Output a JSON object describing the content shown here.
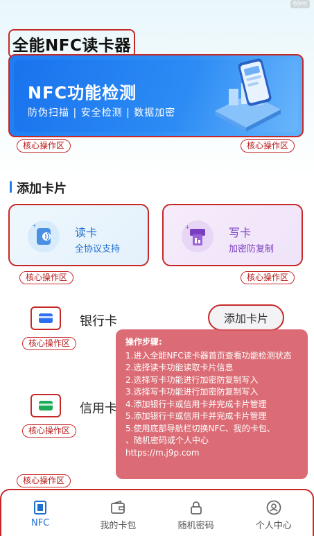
{
  "status": {
    "right_text": "69m"
  },
  "header": {
    "app_title": "全能NFC读卡器"
  },
  "hero": {
    "title": "NFC功能检测",
    "subtitle": "防伪扫描 | 安全检测 | 数据加密"
  },
  "tags": {
    "core_area": "核心操作区"
  },
  "section": {
    "title": "添加卡片"
  },
  "cards": {
    "read": {
      "title": "读卡",
      "subtitle": "全协议支持"
    },
    "write": {
      "title": "写卡",
      "subtitle": "加密防复制"
    }
  },
  "rows": {
    "bank_card": {
      "label": "银行卡",
      "icon": "bank-card-icon",
      "color": "#2e6ff2"
    },
    "credit_card": {
      "label": "信用卡",
      "icon": "credit-card-icon",
      "color": "#1faa59"
    }
  },
  "add_card_button": {
    "label": "添加卡片"
  },
  "popup": {
    "header": "操作步骤:",
    "steps": [
      "1.进入全能NFC读卡器首页查看功能检测状态",
      "2.选择读卡功能读取卡片信息",
      "2.选择写卡功能进行加密防复制写入",
      "3.选择写卡功能进行加密防复制写入",
      "4.添加银行卡或信用卡并完成卡片管理",
      "5.添加银行卡或信用卡并完成卡片管理",
      "5.使用底部导航栏切换NFC、我的卡包、",
      "、随机密码或个人中心",
      "https://m.j9p.com"
    ]
  },
  "nav": {
    "items": [
      {
        "label": "NFC",
        "icon": "nfc-icon"
      },
      {
        "label": "我的卡包",
        "icon": "wallet-icon"
      },
      {
        "label": "随机密码",
        "icon": "lock-icon"
      },
      {
        "label": "个人中心",
        "icon": "user-icon"
      }
    ]
  },
  "colors": {
    "accent": "#1f6fd0",
    "highlight_border": "#c62828",
    "popup_bg": "#d65862"
  }
}
